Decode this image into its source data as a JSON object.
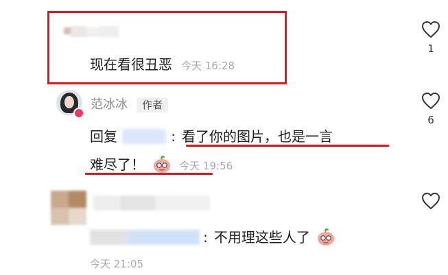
{
  "comments": [
    {
      "text": "现在看很丑恶",
      "time": "今天 16:28",
      "likes": "1"
    },
    {
      "author": "范冰冰",
      "author_badge": "作者",
      "reply_prefix": "回复",
      "reply_colon": ":",
      "text_line1": "看了你的图片，也是一言",
      "text_line2": "难尽了！",
      "time": "今天 19:56",
      "likes": "6"
    },
    {
      "reply_colon": ":",
      "text": "不用理这些人了",
      "time": "今天 21:05"
    }
  ],
  "colors": {
    "highlight": "#e8141c",
    "timestamp": "#a8a8a8",
    "mention": "#a9c8f0"
  },
  "icons": [
    "heart-icon",
    "emoji-sticker-icon",
    "verified-badge-icon"
  ]
}
